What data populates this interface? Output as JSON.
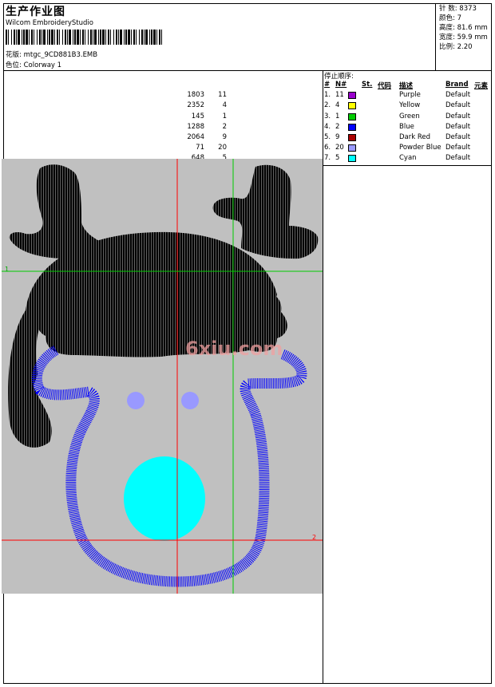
{
  "header": {
    "title": "生产作业图",
    "software": "Wilcom EmbroideryStudio",
    "design_label": "花版:",
    "design_file": "mtgc_9CD881B3.EMB",
    "colorway_label": "色位:",
    "colorway": "Colorway 1"
  },
  "stats": [
    {
      "label": "针 数:",
      "value": "8373"
    },
    {
      "label": "颜色:",
      "value": "7"
    },
    {
      "label": "高度:",
      "value": "81.6 mm"
    },
    {
      "label": "宽度:",
      "value": "59.9 mm"
    },
    {
      "label": "比例:",
      "value": "2.20"
    }
  ],
  "stop_sequence": {
    "title": "停止顺序:",
    "headers": {
      "seq": "#",
      "needle": "N#",
      "stitches": "St.",
      "code": "代码",
      "desc": "描述",
      "brand": "Brand",
      "element": "元素"
    },
    "rows": [
      {
        "seq": "1.",
        "needle": "11",
        "color": "#9900CC",
        "stitches": "1803",
        "code": "11",
        "desc": "Purple",
        "brand": "Default"
      },
      {
        "seq": "2.",
        "needle": "4",
        "color": "#FFFF00",
        "stitches": "2352",
        "code": "4",
        "desc": "Yellow",
        "brand": "Default"
      },
      {
        "seq": "3.",
        "needle": "1",
        "color": "#00CC00",
        "stitches": "145",
        "code": "1",
        "desc": "Green",
        "brand": "Default"
      },
      {
        "seq": "4.",
        "needle": "2",
        "color": "#0000FF",
        "stitches": "1288",
        "code": "2",
        "desc": "Blue",
        "brand": "Default"
      },
      {
        "seq": "5.",
        "needle": "9",
        "color": "#AA0000",
        "stitches": "2064",
        "code": "9",
        "desc": "Dark Red",
        "brand": "Default"
      },
      {
        "seq": "6.",
        "needle": "20",
        "color": "#9999FF",
        "stitches": "71",
        "code": "20",
        "desc": "Powder Blue",
        "brand": "Default"
      },
      {
        "seq": "7.",
        "needle": "5",
        "color": "#00FFFF",
        "stitches": "648",
        "code": "5",
        "desc": "Cyan",
        "brand": "Default"
      }
    ]
  },
  "design": {
    "background": "#C0C0C0",
    "guide_label_1": "1",
    "guide_label_2": "2",
    "watermark": "6xiu.com"
  }
}
